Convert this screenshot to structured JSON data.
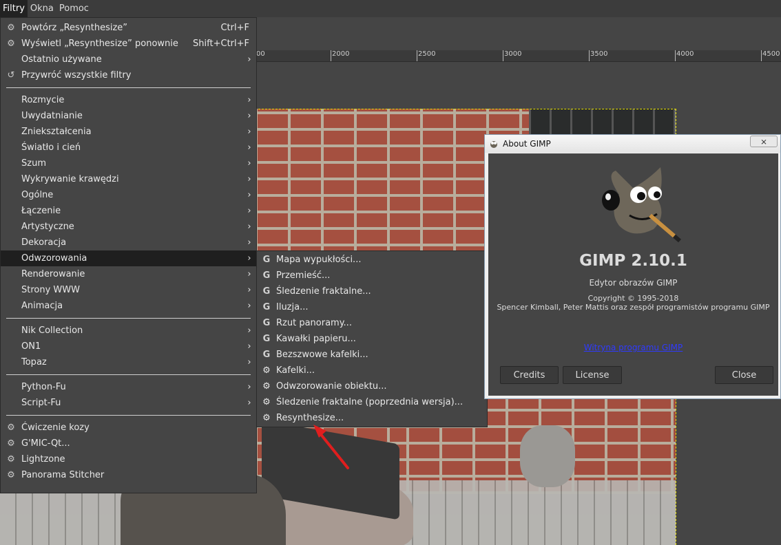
{
  "menubar": {
    "items": [
      "Filtry",
      "Okna",
      "Pomoc"
    ]
  },
  "ruler": {
    "labels": [
      "2000",
      "2500",
      "3000",
      "3500",
      "4000",
      "4500"
    ],
    "edge_label": "00"
  },
  "main_menu": {
    "top_items": [
      {
        "label": "Powtórz „Resynthesize”",
        "shortcut": "Ctrl+F",
        "icon": "gear-icon"
      },
      {
        "label": "Wyświetl „Resynthesize” ponownie",
        "shortcut": "Shift+Ctrl+F",
        "icon": "gear-dialog-icon"
      },
      {
        "label": "Ostatnio używane",
        "shortcut": "",
        "icon": "",
        "submenu": true
      },
      {
        "label": "Przywróć wszystkie filtry",
        "shortcut": "",
        "icon": "reset-icon"
      }
    ],
    "group1": [
      "Rozmycie",
      "Uwydatnianie",
      "Zniekształcenia",
      "Światło i cień",
      "Szum",
      "Wykrywanie krawędzi",
      "Ogólne",
      "Łączenie",
      "Artystyczne",
      "Dekoracja",
      "Odwzorowania",
      "Renderowanie",
      "Strony WWW",
      "Animacja"
    ],
    "highlighted": "Odwzorowania",
    "group2": [
      "Nik Collection",
      "ON1",
      "Topaz"
    ],
    "group3": [
      "Python-Fu",
      "Script-Fu"
    ],
    "group4": [
      "Ćwiczenie kozy",
      "G'MIC-Qt...",
      "Lightzone",
      "Panorama Stitcher"
    ]
  },
  "sub_menu": {
    "items": [
      {
        "label": "Mapa wypukłości...",
        "icon": "gegl-icon"
      },
      {
        "label": "Przemieść...",
        "icon": "gegl-icon"
      },
      {
        "label": "Śledzenie fraktalne...",
        "icon": "gegl-icon"
      },
      {
        "label": "Iluzja...",
        "icon": "gegl-icon"
      },
      {
        "label": "Rzut panoramy...",
        "icon": "gegl-icon"
      },
      {
        "label": "Kawałki papieru...",
        "icon": "gegl-icon"
      },
      {
        "label": "Bezszwowe kafelki...",
        "icon": "gegl-icon"
      },
      {
        "label": "Kafelki...",
        "icon": "gear-icon"
      },
      {
        "label": "Odwzorowanie obiektu...",
        "icon": "gear-icon"
      },
      {
        "label": "Śledzenie fraktalne (poprzednia wersja)...",
        "icon": "gear-icon"
      },
      {
        "label": "Resynthesize...",
        "icon": "gear-icon"
      }
    ]
  },
  "about": {
    "window_title": "About GIMP",
    "close_glyph": "⨯",
    "app_name": "GIMP 2.10.1",
    "description": "Edytor obrazów GIMP",
    "copyright": "Copyright © 1995-2018",
    "authors": "Spencer Kimball, Peter Mattis oraz zespół programistów programu GIMP",
    "link": "Witryna programu GIMP",
    "buttons": {
      "credits": "Credits",
      "license": "License",
      "close": "Close"
    }
  },
  "colors": {
    "menu_bg": "#454545",
    "highlight": "#1f1f1f",
    "link": "#2f3aff",
    "annotation_arrow": "#e01e1e",
    "selection_border": "#e6e000"
  }
}
